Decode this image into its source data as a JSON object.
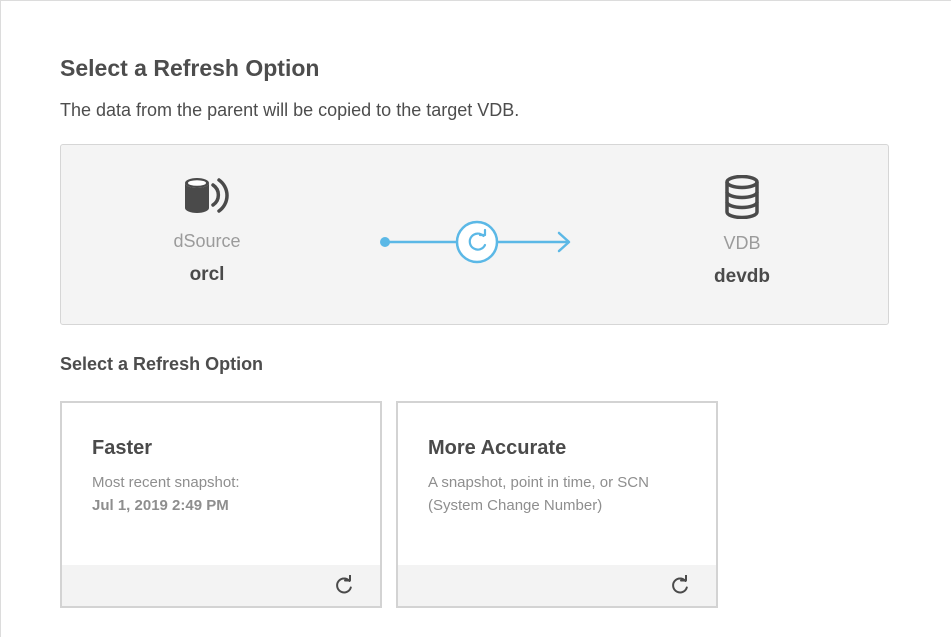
{
  "header": {
    "title": "Select a Refresh Option",
    "subtitle": "The data from the parent will be copied to the target VDB."
  },
  "diagram": {
    "source": {
      "kind": "dSource",
      "name": "orcl",
      "icon": "dsource-database-icon"
    },
    "target": {
      "kind": "VDB",
      "name": "devdb",
      "icon": "database-icon"
    },
    "connector_icon": "refresh-icon",
    "accent_color": "#5bb8e6"
  },
  "options": {
    "title": "Select a Refresh Option",
    "cards": [
      {
        "title": "Faster",
        "line1": "Most recent snapshot:",
        "line2": "Jul 1, 2019 2:49 PM",
        "footer_icon": "refresh-icon"
      },
      {
        "title": "More Accurate",
        "line1": "A snapshot, point in time, or SCN",
        "line2": "(System Change Number)",
        "footer_icon": "refresh-icon"
      }
    ]
  }
}
